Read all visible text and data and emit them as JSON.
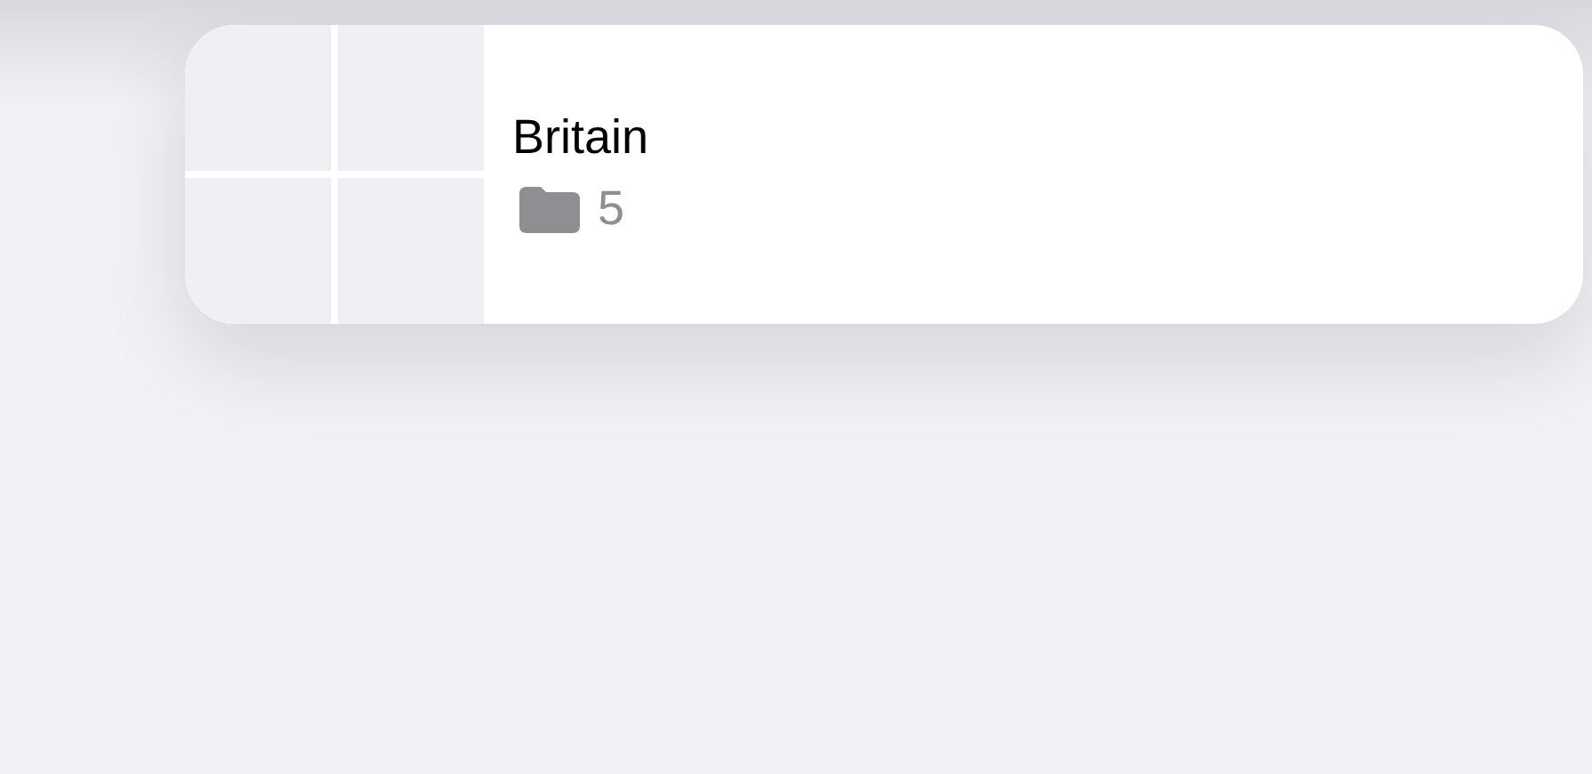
{
  "album": {
    "title": "Britain",
    "count": "5"
  }
}
